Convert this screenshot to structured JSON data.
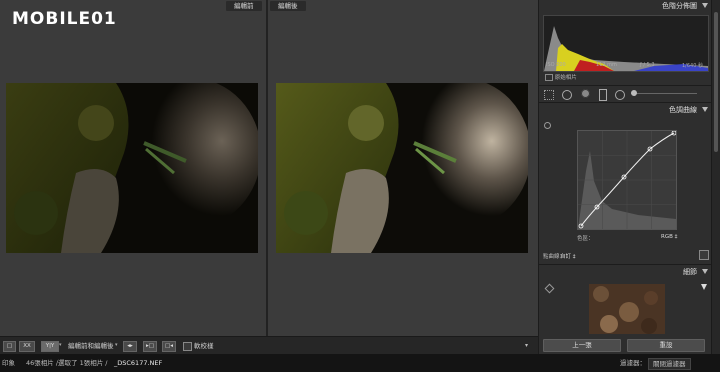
{
  "brand": {
    "logo_text": "MOBILE01"
  },
  "compare": {
    "before_label": "編輯前",
    "after_label": "編輯後"
  },
  "toolbar": {
    "view_single": "□",
    "view_grid": "XX",
    "view_compare": "Y|Y",
    "compare_mode_label": "編輯前和編輯後",
    "soft_proof_label": "軟校樣"
  },
  "statusbar": {
    "source_label": "印象",
    "count_text": "46張相片 /選取了 1張相片 /",
    "filename": "_DSC6177.NEF",
    "filter_label": "過濾器：",
    "filter_value": "關閉過濾器"
  },
  "histogram": {
    "title": "色階分佈圖",
    "iso": "ISO 200",
    "focal": "112 mm",
    "aperture": "ƒ / 5.3",
    "shutter": "1/640 秒",
    "original_label": "原始相片"
  },
  "tone_curve": {
    "title": "色調曲線",
    "region_label": "色區：",
    "channel_label": "RGB ‡",
    "curve_label": "點曲線：",
    "curve_value": "自訂 ‡"
  },
  "detail": {
    "title": "細節"
  },
  "panel_buttons": {
    "previous": "上一張",
    "reset": "重設"
  },
  "colors": {
    "accent": "#e6e6e6",
    "panel_bg": "#2e2e2e",
    "stage_bg": "#3b3b3b"
  }
}
